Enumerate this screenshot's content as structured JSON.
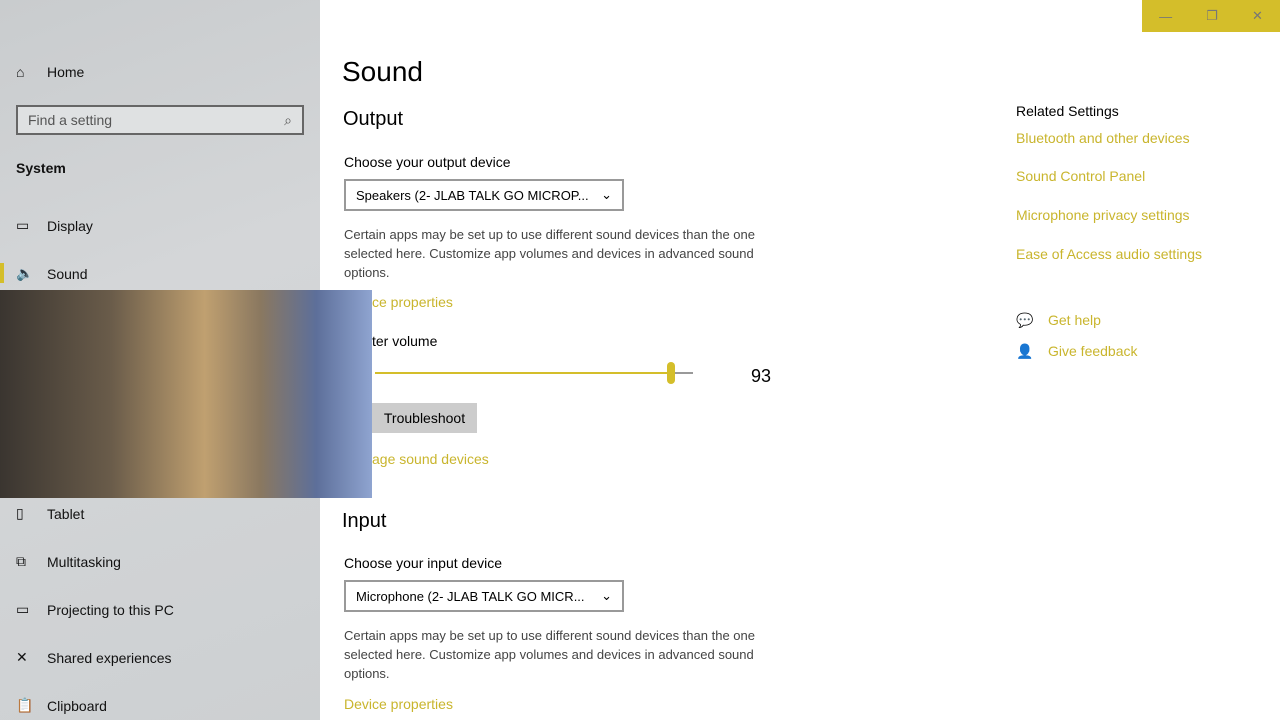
{
  "window": {
    "minimize": "—",
    "restore": "❐",
    "close": "✕",
    "accent": "#d4be2a"
  },
  "sidebar": {
    "home": "Home",
    "search_placeholder": "Find a setting",
    "section": "System",
    "items": [
      {
        "label": "Display",
        "icon": "monitor-icon"
      },
      {
        "label": "Sound",
        "icon": "speaker-icon"
      },
      {
        "label": "Tablet",
        "icon": "tablet-icon"
      },
      {
        "label": "Multitasking",
        "icon": "multitasking-icon"
      },
      {
        "label": "Projecting to this PC",
        "icon": "projector-icon"
      },
      {
        "label": "Shared experiences",
        "icon": "shared-icon"
      },
      {
        "label": "Clipboard",
        "icon": "clipboard-icon"
      }
    ]
  },
  "main": {
    "title": "Sound",
    "output": {
      "heading": "Output",
      "choose_label": "Choose your output device",
      "device": "Speakers (2- JLAB TALK GO MICROP...",
      "desc": "Certain apps may be set up to use different sound devices than the one selected here. Customize app volumes and devices in advanced sound options.",
      "device_props": "ce properties",
      "volume_label": "ter volume",
      "volume": 93,
      "troubleshoot": "Troubleshoot",
      "manage": "age sound devices"
    },
    "input": {
      "heading": "Input",
      "choose_label": "Choose your input device",
      "device": "Microphone (2- JLAB TALK GO MICR...",
      "desc": "Certain apps may be set up to use different sound devices than the one selected here. Customize app volumes and devices in advanced sound options.",
      "device_props": "Device properties"
    }
  },
  "related": {
    "heading": "Related Settings",
    "links": [
      "Bluetooth and other devices",
      "Sound Control Panel",
      "Microphone privacy settings",
      "Ease of Access audio settings"
    ],
    "get_help": "Get help",
    "feedback": "Give feedback"
  }
}
